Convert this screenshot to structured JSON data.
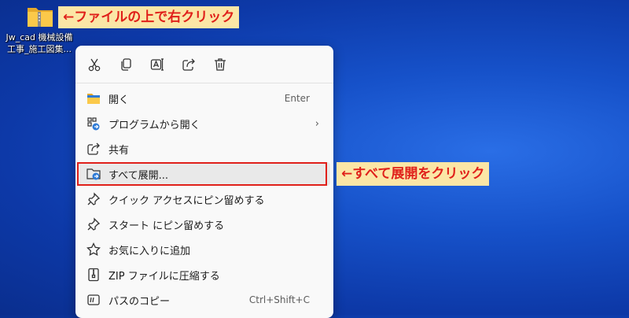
{
  "desktop_icon": {
    "label_line1": "Jw_cad 機械設備",
    "label_line2": "工事_施工図集..."
  },
  "callouts": {
    "right_click": "←ファイルの上で右クリック",
    "extract_all": "←すべて展開をクリック"
  },
  "toolbar": {
    "items": [
      {
        "icon": "cut-icon"
      },
      {
        "icon": "copy-icon"
      },
      {
        "icon": "rename-icon"
      },
      {
        "icon": "share-icon"
      },
      {
        "icon": "delete-icon"
      }
    ]
  },
  "menu": {
    "items": [
      {
        "label": "開く",
        "shortcut": "Enter",
        "icon": "folder-open-icon"
      },
      {
        "label": "プログラムから開く",
        "shortcut": "",
        "icon": "open-with-icon",
        "submenu": "›"
      },
      {
        "label": "共有",
        "shortcut": "",
        "icon": "share-icon"
      },
      {
        "label": "すべて展開...",
        "shortcut": "",
        "icon": "extract-all-icon"
      },
      {
        "label": "クイック アクセスにピン留めする",
        "shortcut": "",
        "icon": "pin-icon"
      },
      {
        "label": "スタート にピン留めする",
        "shortcut": "",
        "icon": "pin-icon"
      },
      {
        "label": "お気に入りに追加",
        "shortcut": "",
        "icon": "star-icon"
      },
      {
        "label": "ZIP ファイルに圧縮する",
        "shortcut": "",
        "icon": "zip-icon"
      },
      {
        "label": "パスのコピー",
        "shortcut": "Ctrl+Shift+C",
        "icon": "copy-path-icon"
      }
    ]
  },
  "colors": {
    "desktop": "#1651c9",
    "callout_bg": "#fbe6a6",
    "callout_text": "#e0201a",
    "highlight_border": "#e0201a"
  }
}
